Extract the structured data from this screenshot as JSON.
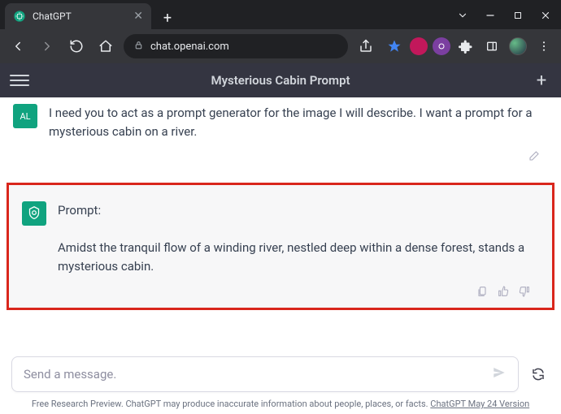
{
  "window": {
    "tab_title": "ChatGPT",
    "url_host": "chat.openai.com"
  },
  "app": {
    "title": "Mysterious Cabin Prompt"
  },
  "messages": {
    "user": {
      "avatar_initials": "AL",
      "text": "I need you to act as a prompt generator for the image I will describe. I want a prompt for a mysterious cabin on a river."
    },
    "assistant": {
      "heading": "Prompt:",
      "text": "Amidst the tranquil flow of a winding river, nestled deep within a dense forest, stands a mysterious cabin."
    }
  },
  "composer": {
    "placeholder": "Send a message."
  },
  "footer": {
    "text": "Free Research Preview. ChatGPT may produce inaccurate information about people, places, or facts. ",
    "link": "ChatGPT May 24 Version"
  }
}
